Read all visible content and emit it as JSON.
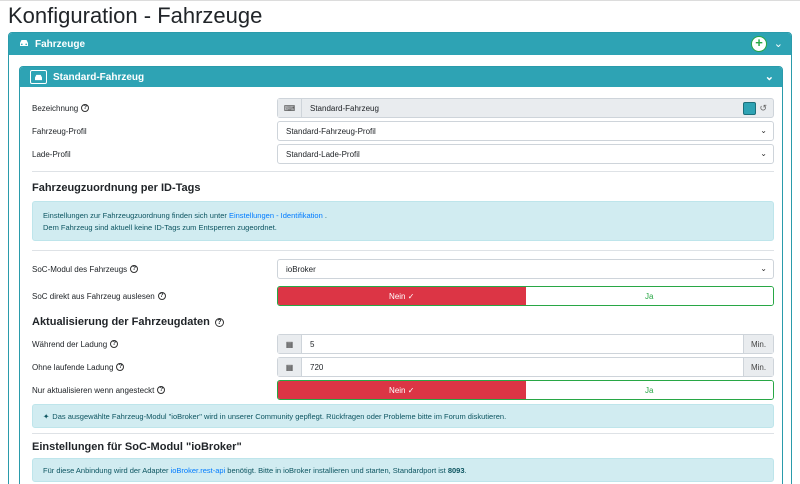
{
  "page": {
    "title": "Konfiguration - Fahrzeuge"
  },
  "outer": {
    "header": "Fahrzeuge",
    "add_icon": "plus-circle-icon",
    "chevron": "chevron-down-icon"
  },
  "vehicle": {
    "header": "Standard-Fahrzeug",
    "fields": {
      "bezeichnung": {
        "label": "Bezeichnung",
        "value": "Standard-Fahrzeug",
        "color": "#2ea3b4"
      },
      "fahrzeug_profil": {
        "label": "Fahrzeug-Profil",
        "value": "Standard-Fahrzeug-Profil"
      },
      "lade_profil": {
        "label": "Lade-Profil",
        "value": "Standard-Lade-Profil"
      }
    },
    "id_tags": {
      "title": "Fahrzeugzuordnung per ID-Tags",
      "info_line1_prefix": "Einstellungen zur Fahrzeugzuordnung finden sich unter ",
      "info_link": "Einstellungen - Identifikation",
      "info_line1_suffix": " .",
      "info_line2": "Dem Fahrzeug sind aktuell keine ID-Tags zum Entsperren zugeordnet."
    },
    "soc": {
      "modul_label": "SoC-Modul des Fahrzeugs",
      "modul_value": "ioBroker",
      "direkt_label": "SoC direkt aus Fahrzeug auslesen",
      "nein": "Nein ✓",
      "ja": "Ja"
    },
    "update": {
      "title": "Aktualisierung der Fahrzeugdaten",
      "ladung_label": "Während der Ladung",
      "ladung_value": "5",
      "ohne_label": "Ohne laufende Ladung",
      "ohne_value": "720",
      "unit": "Min.",
      "angesteckt_label": "Nur aktualisieren wenn angesteckt",
      "nein": "Nein ✓",
      "ja": "Ja",
      "community_info": "Das ausgewählte Fahrzeug-Modul \"ioBroker\" wird in unserer Community gepflegt. Rückfragen oder Probleme bitte im Forum diskutieren."
    },
    "iobroker": {
      "title": "Einstellungen für SoC-Modul \"ioBroker\"",
      "info_prefix": "Für diese Anbindung wird der Adapter ",
      "info_link": "ioBroker.rest-api",
      "info_middle": " benötigt. Bitte in ioBroker installieren und starten, Standardport ist ",
      "info_port": "8093",
      "info_suffix": "."
    }
  }
}
